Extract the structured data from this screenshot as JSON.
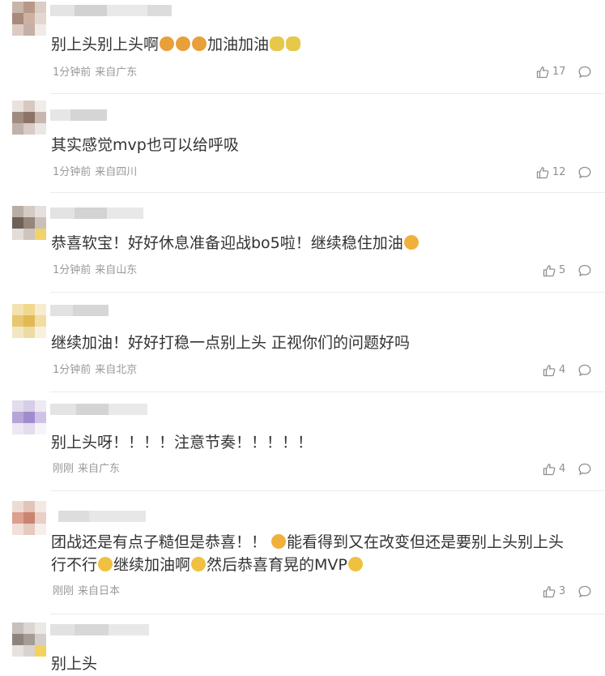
{
  "comments": [
    {
      "text": "别上头别上头啊",
      "emoji1": "😮",
      "text2": "加油加油",
      "emoji2": "💡",
      "time": "1分钟前",
      "location": "来自广东",
      "likes": "17"
    },
    {
      "text": "其实感觉mvp也可以给呼吸",
      "time": "1分钟前",
      "location": "来自四川",
      "likes": "12"
    },
    {
      "text": "恭喜软宝！好好休息准备迎战bo5啦！继续稳住加油",
      "emoji1": "🥰",
      "time": "1分钟前",
      "location": "来自山东",
      "likes": "5"
    },
    {
      "text": "继续加油！好好打稳一点别上头 正视你们的问题好吗",
      "time": "1分钟前",
      "location": "来自北京",
      "likes": "4"
    },
    {
      "text": "别上头呀！！！！注意节奏！！！！！",
      "time": "刚刚",
      "location": "来自广东",
      "likes": "4"
    },
    {
      "line1a": "团战还是有点子糙但是恭喜！！",
      "line1b": "能看得到又在改变但还是要别上头别上头",
      "line2a": "行不行",
      "line2b": "继续加油啊",
      "line2c": "然后恭喜育晃的MVP",
      "time": "刚刚",
      "location": "来自日本",
      "likes": "3"
    },
    {
      "text": "别上头"
    }
  ],
  "colors": {
    "text": "#333333",
    "meta": "#999999",
    "divider": "#ebebeb",
    "icon": "#8f8f8f"
  },
  "icons": {
    "like": "thumbs-up-icon",
    "reply": "speech-bubble-icon"
  }
}
